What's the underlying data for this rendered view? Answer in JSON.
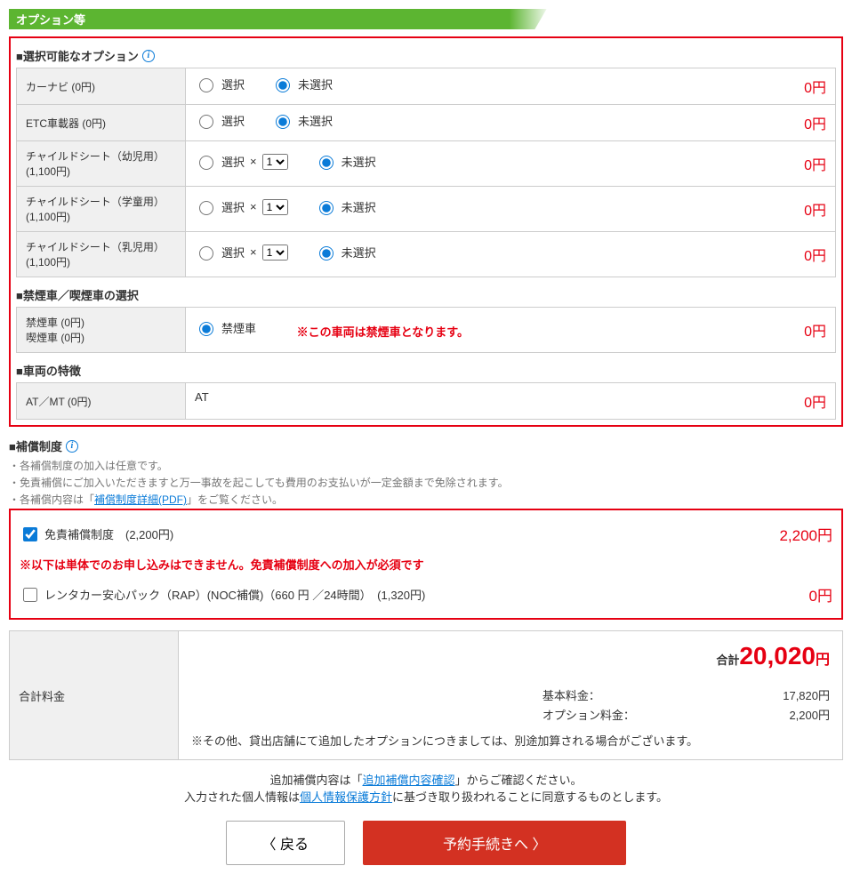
{
  "section_title": "オプション等",
  "options_header": "■選択可能なオプション",
  "radio_select": "選択",
  "radio_unselect": "未選択",
  "qty_x": "×",
  "qty_value": "1",
  "options": [
    {
      "label": "カーナビ (0円)",
      "price": "0円",
      "has_qty": false
    },
    {
      "label": "ETC車載器 (0円)",
      "price": "0円",
      "has_qty": false
    },
    {
      "label": "チャイルドシート（幼児用）(1,100円)",
      "price": "0円",
      "has_qty": true
    },
    {
      "label": "チャイルドシート（学童用）(1,100円)",
      "price": "0円",
      "has_qty": true
    },
    {
      "label": "チャイルドシート（乳児用）(1,100円)",
      "price": "0円",
      "has_qty": true
    }
  ],
  "smoking_header": "■禁煙車／喫煙車の選択",
  "smoking_label_1": "禁煙車 (0円)",
  "smoking_label_2": "喫煙車 (0円)",
  "smoking_radio": "禁煙車",
  "smoking_note": "※この車両は禁煙車となります。",
  "smoking_price": "0円",
  "features_header": "■車両の特徴",
  "features_label": "AT／MT (0円)",
  "features_value": "AT",
  "features_price": "0円",
  "compensation_header": "■補償制度",
  "comp_notes": [
    "・各補償制度の加入は任意です。",
    "・免責補償にご加入いただきますと万一事故を起こしても費用のお支払いが一定金額まで免除されます。"
  ],
  "comp_note_prefix": "・各補償内容は「",
  "comp_link": "補償制度詳細(PDF)",
  "comp_note_suffix": "」をご覧ください。",
  "comp_item1_label": "免責補償制度　(2,200円)",
  "comp_item1_price": "2,200円",
  "comp_warning": "※以下は単体でのお申し込みはできません。免責補償制度への加入が必須です",
  "comp_item2_label": "レンタカー安心パック（RAP）(NOC補償)（660 円 ／24時間）　(1,320円)",
  "comp_item2_price": "0円",
  "total_label": "合計料金",
  "total_prefix": "合計",
  "total_value": "20,020",
  "total_yen": "円",
  "breakdown1_label": "基本料金：",
  "breakdown1_value": "17,820円",
  "breakdown2_label": "オプション料金：",
  "breakdown2_value": "2,200円",
  "total_note": "※その他、貸出店舗にて追加したオプションにつきましては、別途加算される場合がございます。",
  "footer_line1_pre": "追加補償内容は「",
  "footer_link1": "追加補償内容確認",
  "footer_line1_post": "」からご確認ください。",
  "footer_line2_pre": "入力された個人情報は",
  "footer_link2": "個人情報保護方針",
  "footer_line2_post": "に基づき取り扱われることに同意するものとします。",
  "btn_back": "戻る",
  "btn_proceed": "予約手続きへ"
}
